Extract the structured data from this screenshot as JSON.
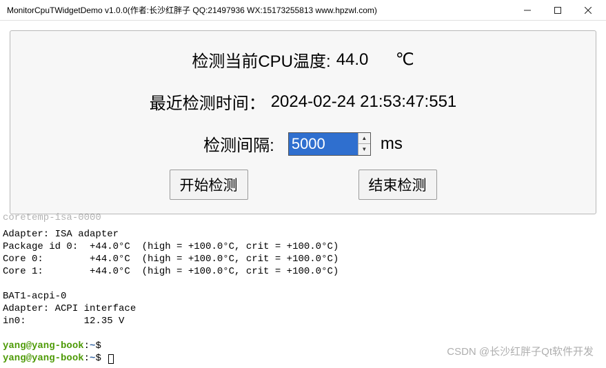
{
  "titlebar": {
    "title": "MonitorCpuTWidgetDemo v1.0.0(作者:长沙红胖子 QQ:21497936 WX:15173255813 www.hpzwl.com)"
  },
  "panel": {
    "temp_label": "检测当前CPU温度:",
    "temp_value": "44.0",
    "temp_unit": "℃",
    "time_label": "最近检测时间：",
    "time_value": "2024-02-24 21:53:47:551",
    "interval_label": "检测间隔:",
    "interval_value": "5000",
    "interval_unit": "ms",
    "start_btn": "开始检测",
    "stop_btn": "结束检测"
  },
  "terminal": {
    "lines": [
      "coretemp-isa-0000",
      "Adapter: ISA adapter",
      "Package id 0:  +44.0°C  (high = +100.0°C, crit = +100.0°C)",
      "Core 0:        +44.0°C  (high = +100.0°C, crit = +100.0°C)",
      "Core 1:        +44.0°C  (high = +100.0°C, crit = +100.0°C)",
      "",
      "BAT1-acpi-0",
      "Adapter: ACPI interface",
      "in0:          12.35 V",
      ""
    ],
    "prompt_user": "yang@yang-book",
    "prompt_path": "~",
    "prompt_sep": ":",
    "prompt_char": "$"
  },
  "watermark": "CSDN @长沙红胖子Qt软件开发"
}
